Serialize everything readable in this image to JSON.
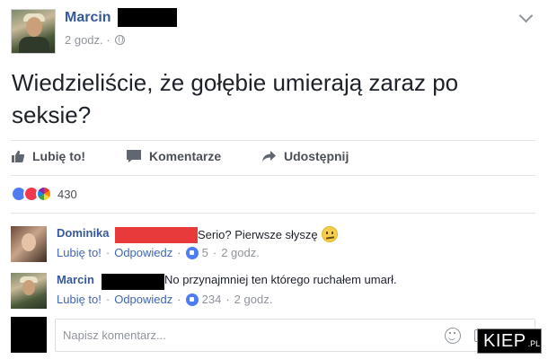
{
  "post": {
    "author": "Marcin",
    "time": "2 godz.",
    "text": "Wiedzieliście, że gołębie umierają zaraz po seksie?"
  },
  "actions": {
    "like": "Lubię to!",
    "comment": "Komentarze",
    "share": "Udostępnij"
  },
  "reactions": {
    "count": "430"
  },
  "comments": [
    {
      "author": "Dominika",
      "text": "Serio? Pierwsze słyszę",
      "like_label": "Lubię to!",
      "reply_label": "Odpowiedz",
      "likes": "5",
      "time": "2 godz."
    },
    {
      "author": "Marcin",
      "text": "No przynajmniej ten którego ruchałem umarł.",
      "like_label": "Lubię to!",
      "reply_label": "Odpowiedz",
      "likes": "234",
      "time": "2 godz."
    }
  ],
  "compose": {
    "placeholder": "Napisz komentarz..."
  },
  "watermark": {
    "brand": "KIEP",
    "tld": ".PL"
  },
  "colors": {
    "link": "#365899",
    "meta": "#90949c",
    "redact_red": "#e83a3a"
  }
}
